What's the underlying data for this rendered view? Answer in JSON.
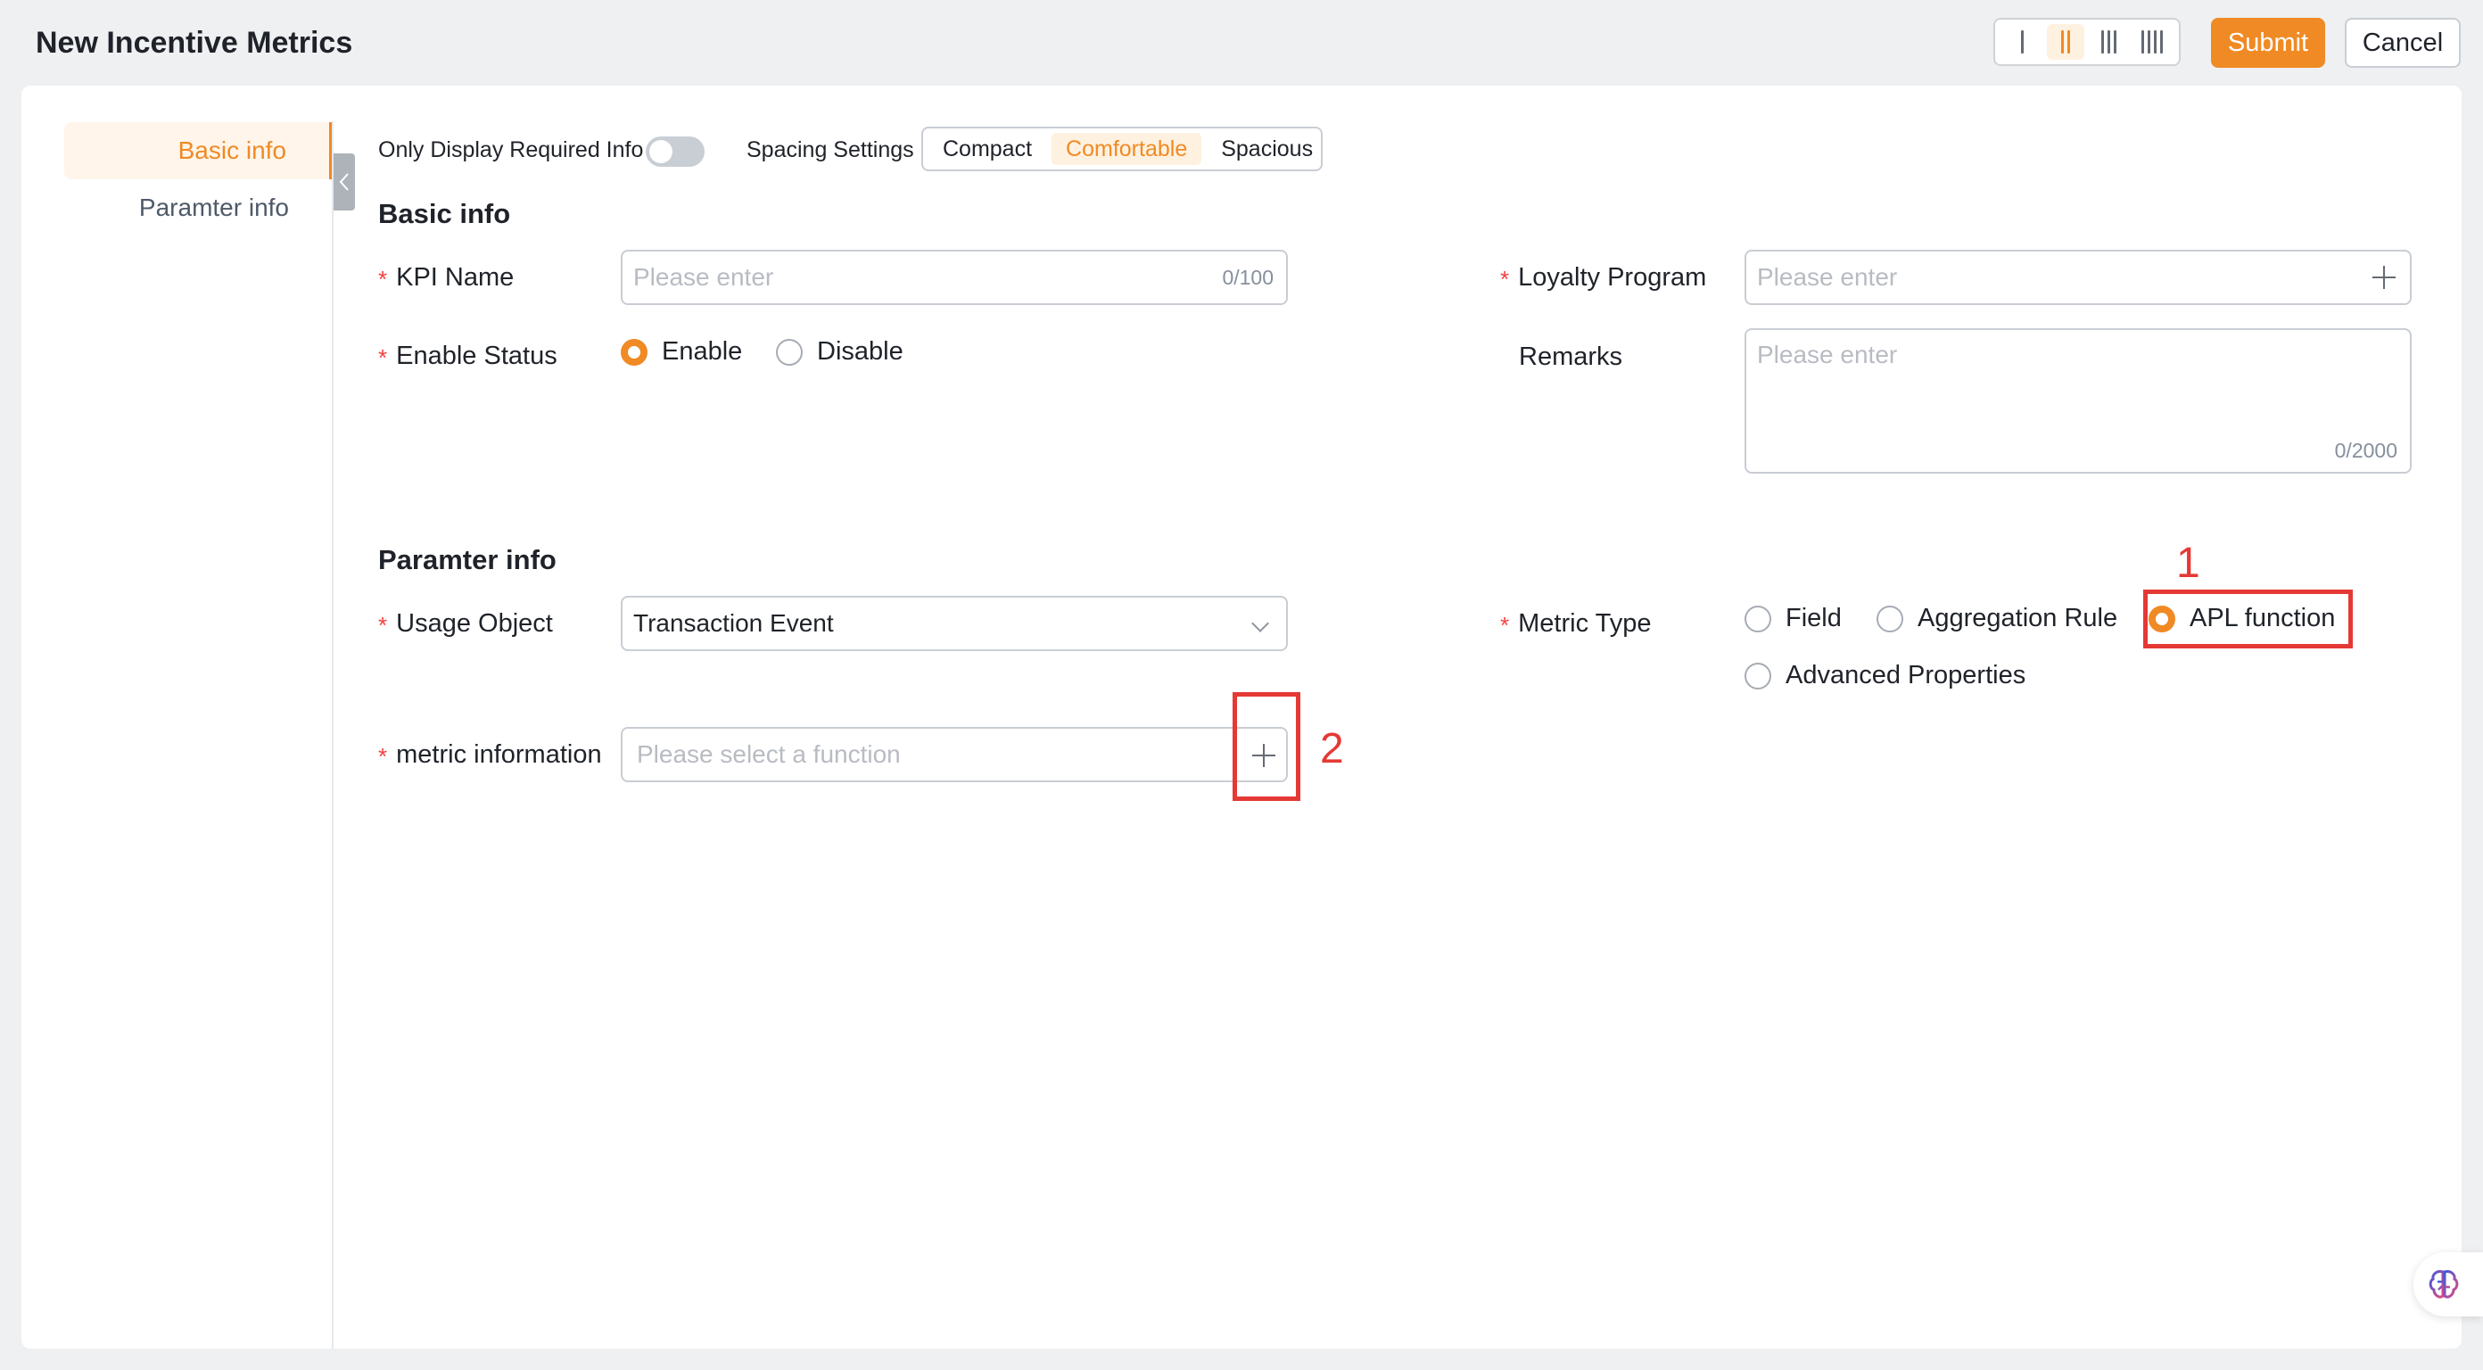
{
  "header": {
    "title": "New Incentive Metrics",
    "layout_options": [
      "I",
      "II",
      "III",
      "IIII"
    ],
    "active_layout": "II",
    "submit_label": "Submit",
    "cancel_label": "Cancel"
  },
  "sidebar": {
    "items": [
      {
        "label": "Basic info",
        "active": true
      },
      {
        "label": "Paramter info",
        "active": false
      }
    ]
  },
  "topbar": {
    "required_only_label": "Only Display Required Info",
    "required_only_on": false,
    "spacing_label": "Spacing Settings",
    "spacing_options": [
      "Compact",
      "Comfortable",
      "Spacious"
    ],
    "spacing_selected": "Comfortable"
  },
  "basic_info": {
    "title": "Basic info",
    "kpi_name": {
      "label": "KPI Name",
      "placeholder": "Please enter",
      "counter": "0/100",
      "required": true
    },
    "loyalty_program": {
      "label": "Loyalty Program",
      "placeholder": "Please enter",
      "required": true
    },
    "enable_status": {
      "label": "Enable Status",
      "options": [
        "Enable",
        "Disable"
      ],
      "selected": "Enable",
      "required": true
    },
    "remarks": {
      "label": "Remarks",
      "placeholder": "Please enter",
      "counter": "0/2000"
    }
  },
  "param_info": {
    "title": "Paramter info",
    "usage_object": {
      "label": "Usage Object",
      "value": "Transaction Event",
      "required": true
    },
    "metric_type": {
      "label": "Metric Type",
      "options": [
        "Field",
        "Aggregation Rule",
        "APL function",
        "Advanced Properties"
      ],
      "selected": "APL function",
      "required": true
    },
    "metric_information": {
      "label": "metric information",
      "placeholder": "Please select a function",
      "required": true
    }
  },
  "annotations": [
    "1",
    "2"
  ],
  "colors": {
    "accent": "#f08a24",
    "required": "#f53f3f",
    "annotation": "#e53935"
  },
  "icons": {
    "collapse": "chevron-left-icon",
    "add": "plus-icon",
    "dropdown": "chevron-down-icon",
    "assistant": "brain-icon"
  }
}
